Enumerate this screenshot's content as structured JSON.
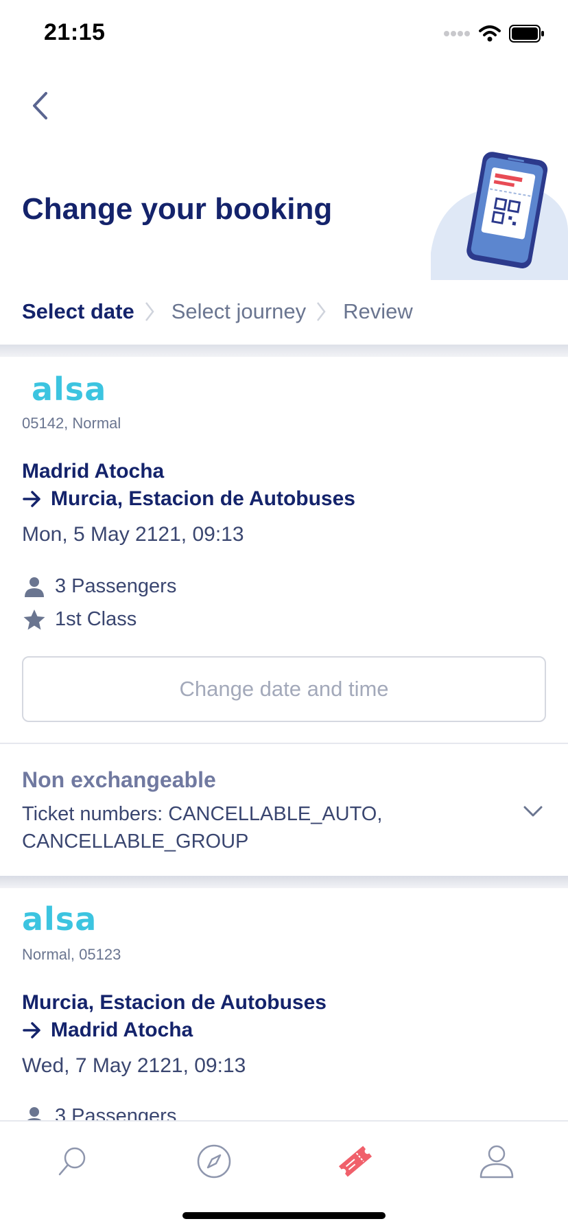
{
  "status_bar": {
    "time": "21:15"
  },
  "header": {
    "title": "Change your booking"
  },
  "steps": [
    {
      "label": "Select date"
    },
    {
      "label": "Select journey"
    },
    {
      "label": "Review"
    }
  ],
  "outbound": {
    "operator": "alsa",
    "service": "05142, Normal",
    "origin": "Madrid Atocha",
    "destination": "Murcia, Estacion de Autobuses",
    "datetime": "Mon, 5 May 2121, 09:13",
    "passengers": "3 Passengers",
    "class": "1st Class",
    "change_button": "Change date and time"
  },
  "non_exchangeable": {
    "title": "Non exchangeable",
    "tickets": "Ticket numbers: CANCELLABLE_AUTO, CANCELLABLE_GROUP"
  },
  "inbound": {
    "operator": "alsa",
    "service": "Normal, 05123",
    "origin": "Murcia, Estacion de Autobuses",
    "destination": "Madrid Atocha",
    "datetime": "Wed, 7 May 2121, 09:13",
    "passengers": "3 Passengers"
  },
  "tab_bar": {
    "items": [
      {
        "icon": "search-icon"
      },
      {
        "icon": "compass-icon"
      },
      {
        "icon": "ticket-icon",
        "active": true
      },
      {
        "icon": "user-icon"
      }
    ]
  },
  "colors": {
    "primary": "#14236b",
    "secondary_text": "#6a7590",
    "brand_alsa": "#3cc4e0",
    "active_tab": "#f0606b"
  }
}
